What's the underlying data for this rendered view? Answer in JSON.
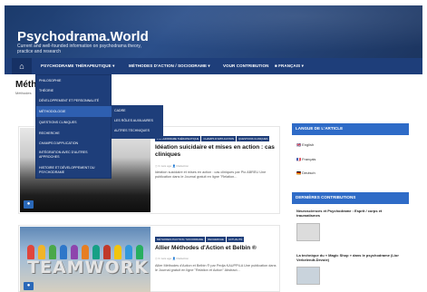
{
  "site": {
    "title": "Psychodrama.World",
    "description": "Current and well-founded information on psychodrama theory, practice and research"
  },
  "nav": {
    "home_icon": "home-icon",
    "items": [
      "PSYCHODRAME THÉRAPEUTIQUE ▾",
      "MÉTHODES D'ACTION / SOCIODRAME ▾",
      "VOUR CONTRIBUTION",
      "■ FRANÇAIS ▾"
    ]
  },
  "page": {
    "title": "Méth                       odrame",
    "breadcrumb": "Méthodes"
  },
  "dropdown": {
    "items": [
      "PHILOSOPHIE",
      "THÉORIE",
      "DÉVELOPPEMENT ET PERSONNALITÉ",
      "MÉTHODOLOGIE",
      "QUESTIONS CLINIQUES",
      "RECHERCHE",
      "CHAMPS D'APPLICATION",
      "INTÉGRATION AVEC D'AUTRES APPROCHES",
      "HISTOIRE ET DÉVELOPPEMENT DU PSYCHODRAME"
    ],
    "submenu": [
      "CADRE",
      "LES RÔLES AUXILIAIRES",
      "AUTRES TECHNIQUES"
    ]
  },
  "posts": [
    {
      "tags": [
        "PSYCHODRAME THÉRAPEUTIQUE",
        "CHAMPS D'APPLICATION",
        "QUESTIONS CLINIQUES"
      ],
      "title": "Idéation suicidaire et mises en action : cas cliniques",
      "meta": "◷ 3 mois ago    👤 Rédaction",
      "excerpt": "Idéation suicidaire et mises en action : cas cliniques par Pio ABREU Une publication dans le Journal gratuit en ligne \"Relation..."
    },
    {
      "tags": [
        "MÉTHODES D'ACTION / SOCIODRAME",
        "RECHERCHE",
        "ACTUALITÉ"
      ],
      "title": "Allier Méthodes d'Action et Belbin ®",
      "meta": "◷ 3 mois ago    👤 Rédaction",
      "excerpt": "Allier Méthodes d'Action et Belbin ® par Pedja KAUPPILA Une publication dans le Journal gratuit en ligne \"Relation et Action\" Abstract..."
    }
  ],
  "teamwork_text": "TEAMWORK",
  "sidebar": {
    "lang_widget": {
      "title": "LANGUE DE L'ARTICLE",
      "items": [
        "🇬🇧 English",
        "🇫🇷 Français",
        "🇩🇪 Deutsch"
      ]
    },
    "recent_widget": {
      "title": "DERNIÈRES CONTRIBUTIONS",
      "items": [
        "Neurosciences et Psychodrame : Esprit / corps et traumatismes",
        "La technique du « Magic Shop » dans le psychodrame (Lior Verkelendt-Devoie)"
      ]
    }
  },
  "colors": {
    "nav": "#1e3e7a",
    "accent": "#2e6bc7"
  }
}
